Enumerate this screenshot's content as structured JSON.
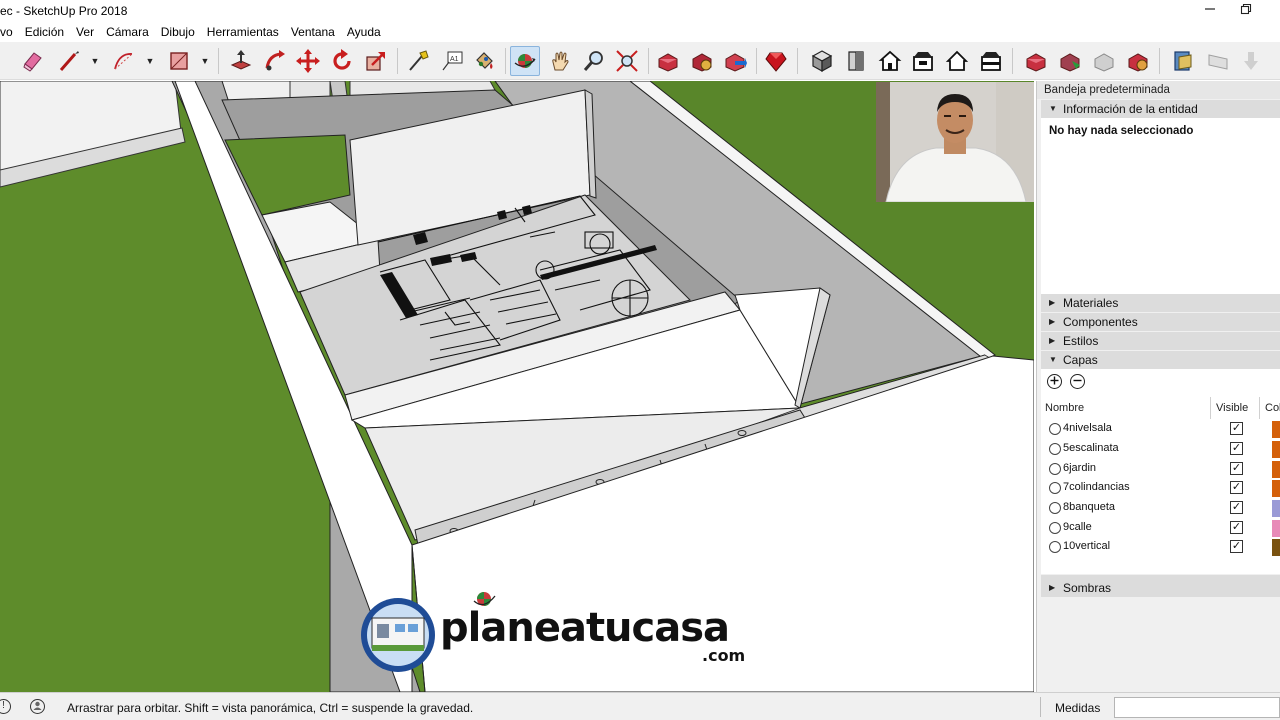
{
  "window": {
    "title": "ec - SketchUp Pro 2018",
    "controls": [
      "minimize",
      "maximize"
    ]
  },
  "menu": [
    "vo",
    "Edición",
    "Ver",
    "Cámara",
    "Dibujo",
    "Herramientas",
    "Ventana",
    "Ayuda"
  ],
  "toolbar": {
    "tools": [
      {
        "name": "eraser-tool-icon",
        "active": false
      },
      {
        "name": "line-tool-icon",
        "active": false
      },
      {
        "name": "arc-tool-icon",
        "active": false
      },
      {
        "name": "rectangle-tool-icon",
        "active": false
      },
      {
        "name": "push-pull-tool-icon",
        "active": false
      },
      {
        "name": "follow-me-tool-icon",
        "active": false
      },
      {
        "name": "move-tool-icon",
        "active": false
      },
      {
        "name": "rotate-tool-icon",
        "active": false
      },
      {
        "name": "scale-tool-icon",
        "active": false
      },
      {
        "name": "tape-measure-tool-icon",
        "active": false
      },
      {
        "name": "text-tool-icon",
        "active": false
      },
      {
        "name": "paint-bucket-tool-icon",
        "active": false
      },
      {
        "name": "orbit-tool-icon",
        "active": true
      },
      {
        "name": "pan-tool-icon",
        "active": false
      },
      {
        "name": "zoom-tool-icon",
        "active": false
      },
      {
        "name": "zoom-extents-tool-icon",
        "active": false
      },
      {
        "name": "warehouse-icon",
        "active": false
      },
      {
        "name": "extension-warehouse-icon",
        "active": false
      },
      {
        "name": "share-model-icon",
        "active": false
      },
      {
        "name": "ruby-console-icon",
        "active": false
      },
      {
        "name": "iso-view-icon",
        "active": false
      },
      {
        "name": "top-view-icon",
        "active": false
      },
      {
        "name": "front-view-icon",
        "active": false
      },
      {
        "name": "right-view-icon",
        "active": false
      },
      {
        "name": "back-view-icon",
        "active": false
      },
      {
        "name": "left-view-icon",
        "active": false
      },
      {
        "name": "add-location-icon",
        "active": false
      },
      {
        "name": "toggle-terrain-icon",
        "active": false
      },
      {
        "name": "photo-textures-icon",
        "active": false
      },
      {
        "name": "preview-google-earth-icon",
        "active": false
      },
      {
        "name": "section-plane-icon",
        "active": false
      },
      {
        "name": "display-section-icon",
        "active": false
      },
      {
        "name": "download-icon",
        "active": false
      }
    ]
  },
  "viewport": {
    "watermark": {
      "main_prefix": "planea",
      "main_suffix": "tucasa",
      "domain": ".com"
    }
  },
  "panel": {
    "tray_title": "Bandeja predeterminada",
    "entity_info": {
      "title": "Información de la entidad",
      "message": "No hay nada seleccionado"
    },
    "sections": [
      "Materiales",
      "Componentes",
      "Estilos",
      "Capas"
    ],
    "layers": {
      "headers": {
        "name": "Nombre",
        "visible": "Visible",
        "color": "Col"
      },
      "rows": [
        {
          "name": "4nivelsala",
          "visible": "✓",
          "color": "#d4600a"
        },
        {
          "name": "5escalinata",
          "visible": "✓",
          "color": "#d4600a"
        },
        {
          "name": "6jardin",
          "visible": "✓",
          "color": "#d4600a"
        },
        {
          "name": "7colindancias",
          "visible": "✓",
          "color": "#d4600a"
        },
        {
          "name": "8banqueta",
          "visible": "✓",
          "color": "#9a9ad6"
        },
        {
          "name": "9calle",
          "visible": "✓",
          "color": "#e88ab8"
        },
        {
          "name": "10vertical",
          "visible": "✓",
          "color": "#7a5210"
        }
      ]
    },
    "shadows": "Sombras"
  },
  "statusbar": {
    "hint": "Arrastrar para orbitar. Shift = vista panorámica, Ctrl = suspende la gravedad.",
    "measurements_label": "Medidas"
  }
}
